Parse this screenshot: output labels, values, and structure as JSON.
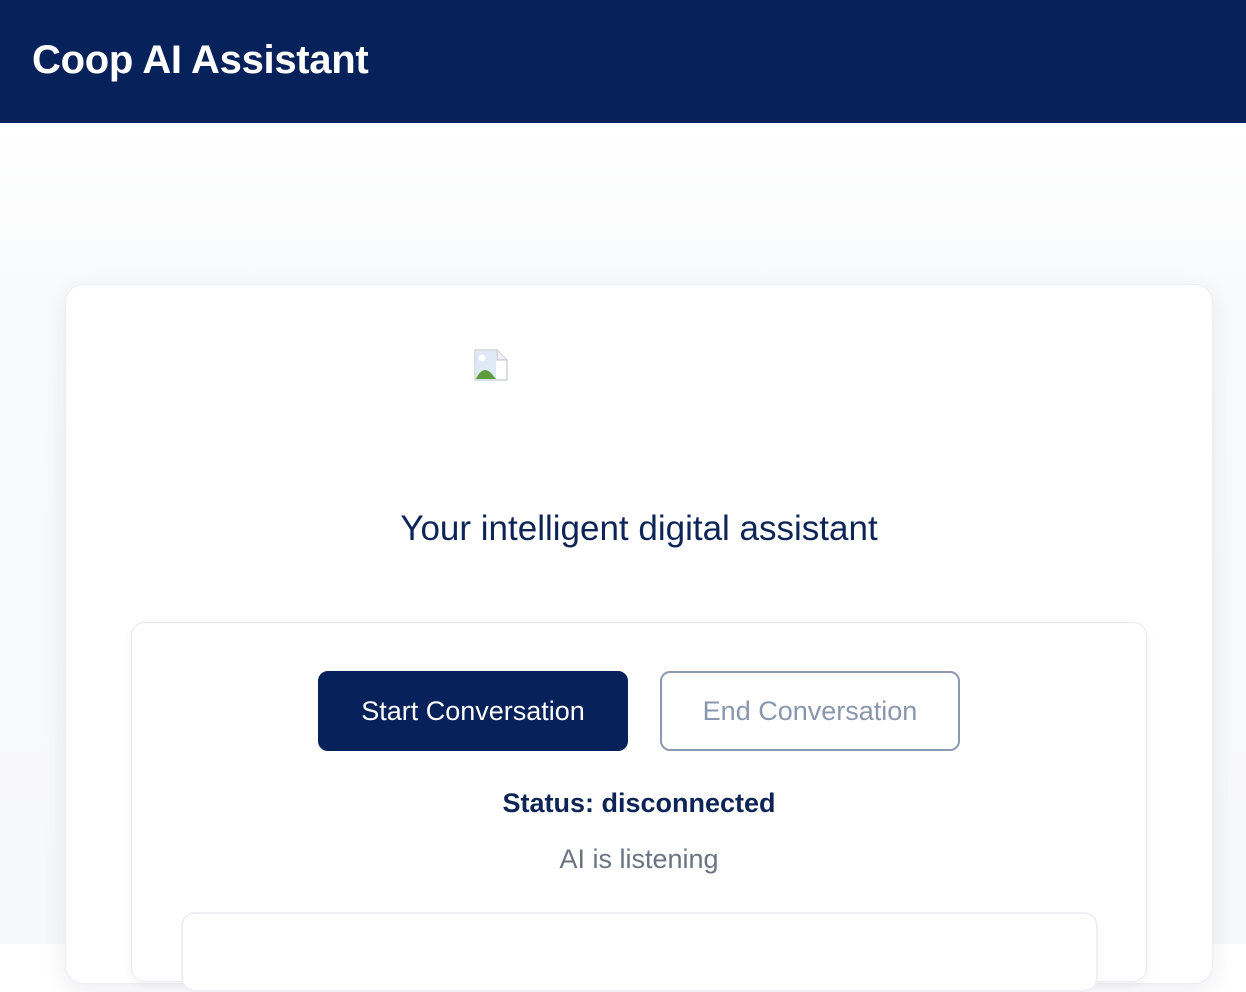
{
  "header": {
    "title": "Coop AI Assistant",
    "background_color": "#07215a"
  },
  "hero": {
    "logo_icon": "broken-image-icon",
    "tagline": "Your intelligent digital assistant"
  },
  "controls": {
    "start_label": "Start Conversation",
    "end_label": "End Conversation",
    "status_text": "Status: disconnected",
    "listening_text": "AI is listening"
  },
  "colors": {
    "primary": "#07215a",
    "muted_button": "#8a96ad",
    "secondary_text": "#6b7280"
  }
}
